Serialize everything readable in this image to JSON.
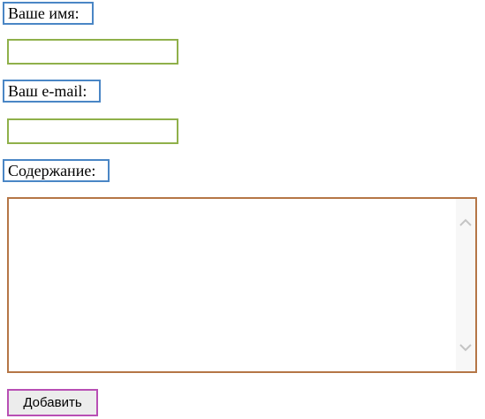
{
  "form": {
    "name_label": "Ваше имя:",
    "name_value": "",
    "email_label": "Ваш e-mail:",
    "email_value": "",
    "content_label": "Содержание:",
    "content_value": "",
    "submit_label": "Добавить"
  },
  "icons": {
    "scroll_up": "chevron-up-icon",
    "scroll_down": "chevron-down-icon"
  },
  "colors": {
    "label_border": "#4a86c5",
    "input_border": "#8fb04a",
    "textarea_border": "#b57646",
    "button_border": "#b84fb4"
  }
}
